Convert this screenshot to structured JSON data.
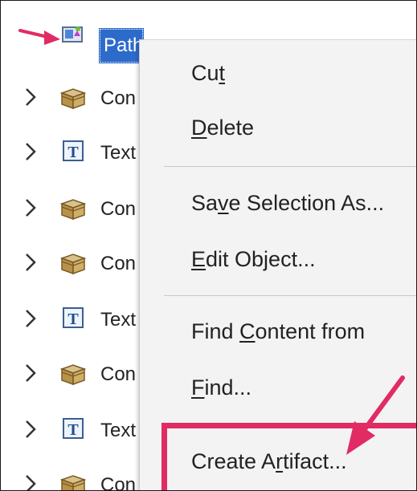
{
  "tree": {
    "selected_label": "Path",
    "rows": [
      {
        "icon": "container-box-icon",
        "label": "Con"
      },
      {
        "icon": "text-t-icon",
        "label": "Text"
      },
      {
        "icon": "container-box-icon",
        "label": "Con"
      },
      {
        "icon": "container-box-icon",
        "label": "Con"
      },
      {
        "icon": "text-t-icon",
        "label": "Text"
      },
      {
        "icon": "container-box-icon",
        "label": "Con"
      },
      {
        "icon": "text-t-icon",
        "label": "Text"
      },
      {
        "icon": "container-box-icon",
        "label": "Con"
      }
    ]
  },
  "menu": {
    "cut": {
      "pre": "Cu",
      "key": "t",
      "post": ""
    },
    "delete": {
      "pre": "",
      "key": "D",
      "post": "elete"
    },
    "save_selection": {
      "pre": "Sa",
      "key": "v",
      "post": "e Selection As..."
    },
    "edit_object": {
      "pre": "",
      "key": "E",
      "post": "dit Object..."
    },
    "find_content": {
      "pre": "Find ",
      "key": "C",
      "post": "ontent from"
    },
    "find": {
      "pre": "",
      "key": "F",
      "post": "ind..."
    },
    "create_artifact": {
      "pre": "Create A",
      "key": "r",
      "post": "tifact..."
    }
  },
  "colors": {
    "annotation": "#e02c63",
    "selection": "#2d6bcb"
  }
}
